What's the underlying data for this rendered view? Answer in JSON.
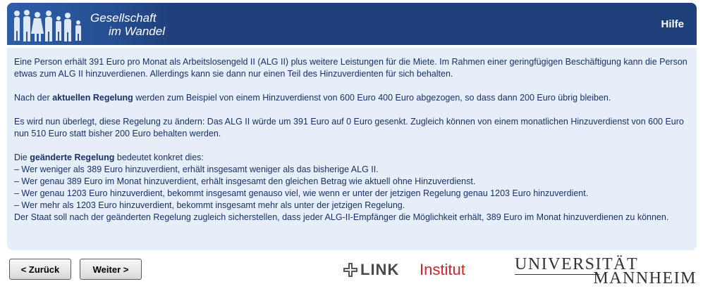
{
  "header": {
    "logo_line1": "Gesellschaft",
    "logo_line2": "im Wandel",
    "help_label": "Hilfe",
    "bg_color": "#1f3f7a"
  },
  "content": {
    "p1": "Eine Person erhält 391 Euro pro Monat als Arbeitslosengeld II (ALG II) plus weitere Leistungen für die Miete. Im Rahmen einer geringfügigen Beschäftigung kann die Person etwas zum ALG II hinzuverdienen. Allerdings kann sie dann nur einen Teil des Hinzuverdienten für sich behalten.",
    "p2_pre": "Nach der ",
    "p2_bold": "aktuellen Regelung",
    "p2_post": " werden zum Beispiel von einem Hinzuverdienst von 600 Euro 400 Euro abgezogen, so dass dann 200 Euro übrig bleiben.",
    "p3": "Es wird nun überlegt, diese Regelung zu ändern: Das ALG II würde um 391 Euro auf 0 Euro gesenkt. Zugleich können von einem monatlichen Hinzuverdienst von 600 Euro nun 510 Euro statt bisher 200 Euro behalten werden.",
    "p4_pre": "Die ",
    "p4_bold": "geänderte Regelung",
    "p4_post": " bedeutet konkret dies:",
    "bullets": [
      "– Wer weniger als 389 Euro hinzuverdient, erhält insgesamt weniger als das bisherige ALG II.",
      "– Wer genau 389 Euro im Monat hinzuverdient, erhält insgesamt den gleichen Betrag wie aktuell ohne Hinzuverdienst.",
      "– Wer genau 1203 Euro hinzuverdient, bekommt insgesamt genauso viel, wie wenn er unter der jetzigen Regelung genau 1203 Euro hinzuverdient.",
      "– Wer mehr als 1203 Euro hinzuverdient, bekommt insgesamt mehr als unter der jetzigen Regelung."
    ],
    "closing": "Der Staat soll nach der geänderten Regelung zugleich sicherstellen, dass jeder ALG-II-Empfänger die Möglichkeit erhält, 389 Euro im Monat hinzuverdienen zu können."
  },
  "nav": {
    "back_label": "< Zurück",
    "next_label": "Weiter >"
  },
  "footer": {
    "link_word": "LINK",
    "link_institut": "Institut",
    "uni_line1": "UNIVERSITÄT",
    "uni_line2": "MANNHEIM"
  }
}
